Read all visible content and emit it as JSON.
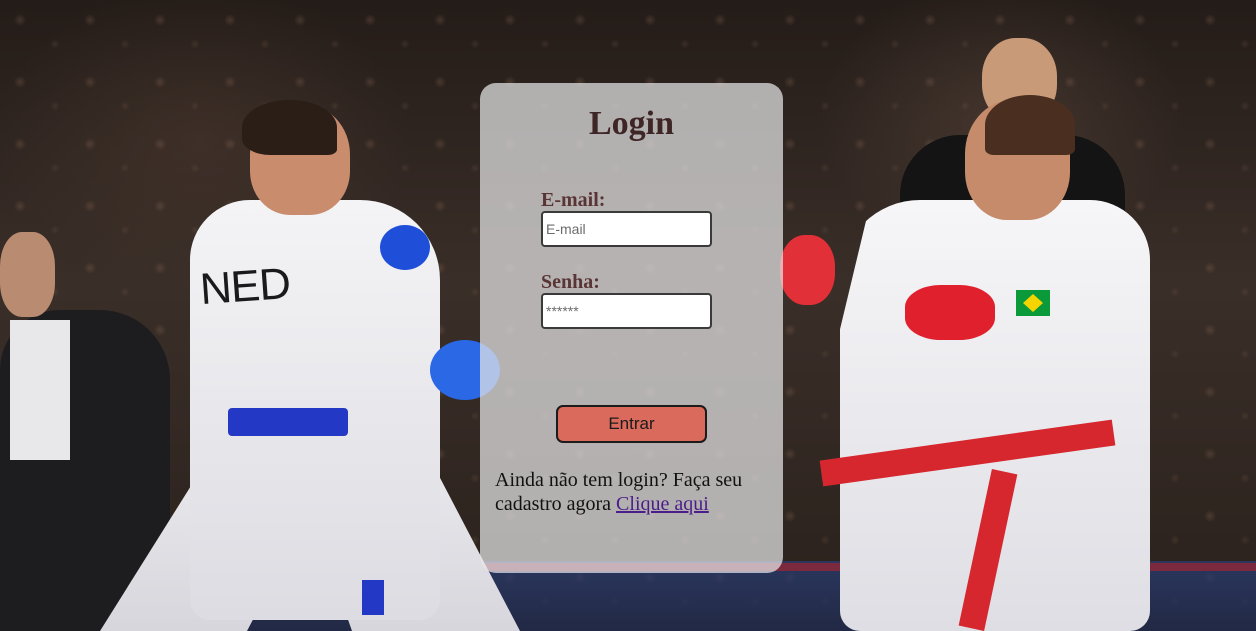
{
  "login_card": {
    "title": "Login",
    "email_label": "E-mail:",
    "email_placeholder": "E-mail",
    "email_value": "",
    "password_label": "Senha:",
    "password_placeholder": "******",
    "password_value": "",
    "submit_label": "Entrar",
    "signup_prompt": "Ainda não tem login? Faça seu cadastro agora",
    "signup_link": "Clique aqui"
  },
  "background": {
    "gi_text": "NED"
  },
  "colors": {
    "card_bg": "#e6e6e8",
    "title": "#3f2626",
    "labels": "#5a3535",
    "button": "#d96a5c",
    "link": "#4b1d8a"
  }
}
